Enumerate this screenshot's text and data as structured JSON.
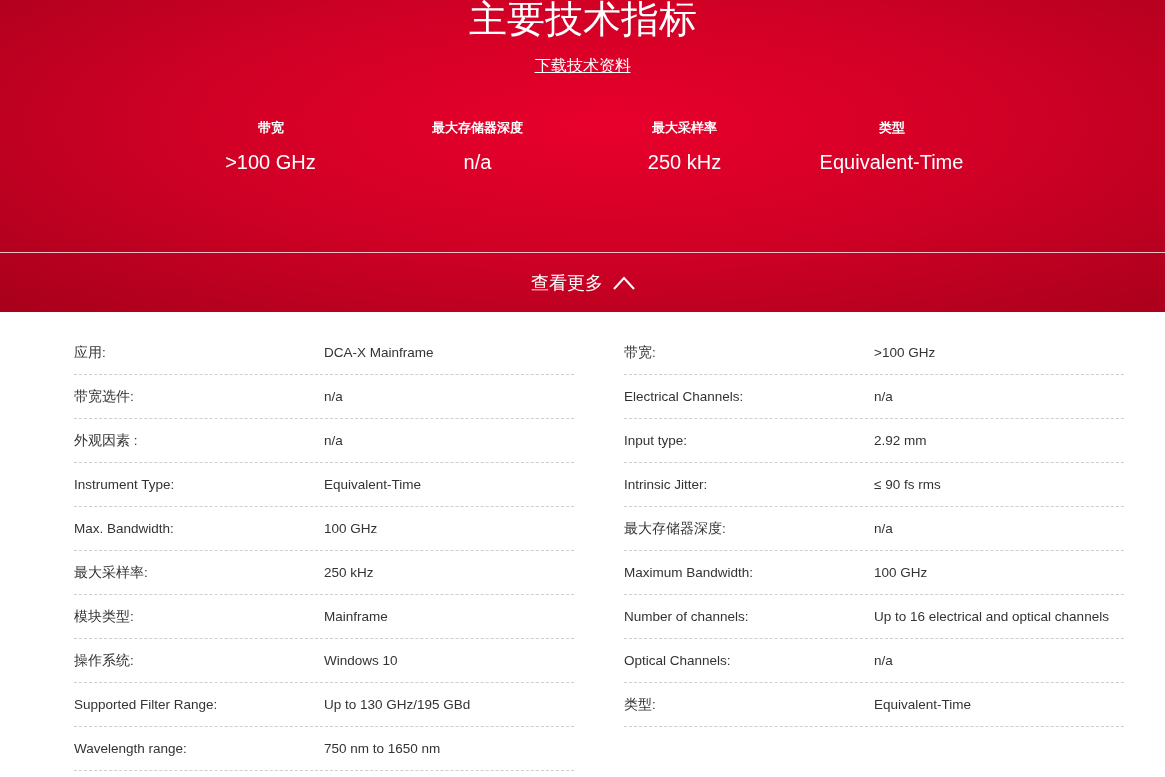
{
  "hero": {
    "title": "主要技术指标",
    "download_link": "下载技术资料",
    "key_specs": [
      {
        "label": "带宽",
        "value": ">100 GHz"
      },
      {
        "label": "最大存储器深度",
        "value": "n/a"
      },
      {
        "label": "最大采样率",
        "value": "250 kHz"
      },
      {
        "label": "类型",
        "value": "Equivalent-Time"
      }
    ]
  },
  "toggle": {
    "label": "查看更多",
    "expanded": true
  },
  "spec_columns": [
    [
      {
        "name": "应用:",
        "value": "DCA-X Mainframe"
      },
      {
        "name": "带宽选件:",
        "value": "n/a"
      },
      {
        "name": "外观因素 :",
        "value": "n/a"
      },
      {
        "name": "Instrument Type:",
        "value": "Equivalent-Time"
      },
      {
        "name": "Max. Bandwidth:",
        "value": "100 GHz"
      },
      {
        "name": "最大采样率:",
        "value": "250 kHz"
      },
      {
        "name": "模块类型:",
        "value": "Mainframe"
      },
      {
        "name": "操作系统:",
        "value": "Windows 10"
      },
      {
        "name": "Supported Filter Range:",
        "value": "Up to 130 GHz/195 GBd"
      },
      {
        "name": "Wavelength range:",
        "value": "750 nm to 1650 nm"
      }
    ],
    [
      {
        "name": "带宽:",
        "value": ">100 GHz"
      },
      {
        "name": "Electrical Channels:",
        "value": "n/a"
      },
      {
        "name": "Input type:",
        "value": "2.92 mm"
      },
      {
        "name": "Intrinsic Jitter:",
        "value": "≤ 90 fs rms"
      },
      {
        "name": "最大存储器深度:",
        "value": "n/a"
      },
      {
        "name": "Maximum Bandwidth:",
        "value": "100 GHz"
      },
      {
        "name": "Number of channels:",
        "value": "Up to 16 electrical and optical channels"
      },
      {
        "name": "Optical Channels:",
        "value": "n/a"
      },
      {
        "name": "类型:",
        "value": "Equivalent-Time"
      }
    ]
  ]
}
